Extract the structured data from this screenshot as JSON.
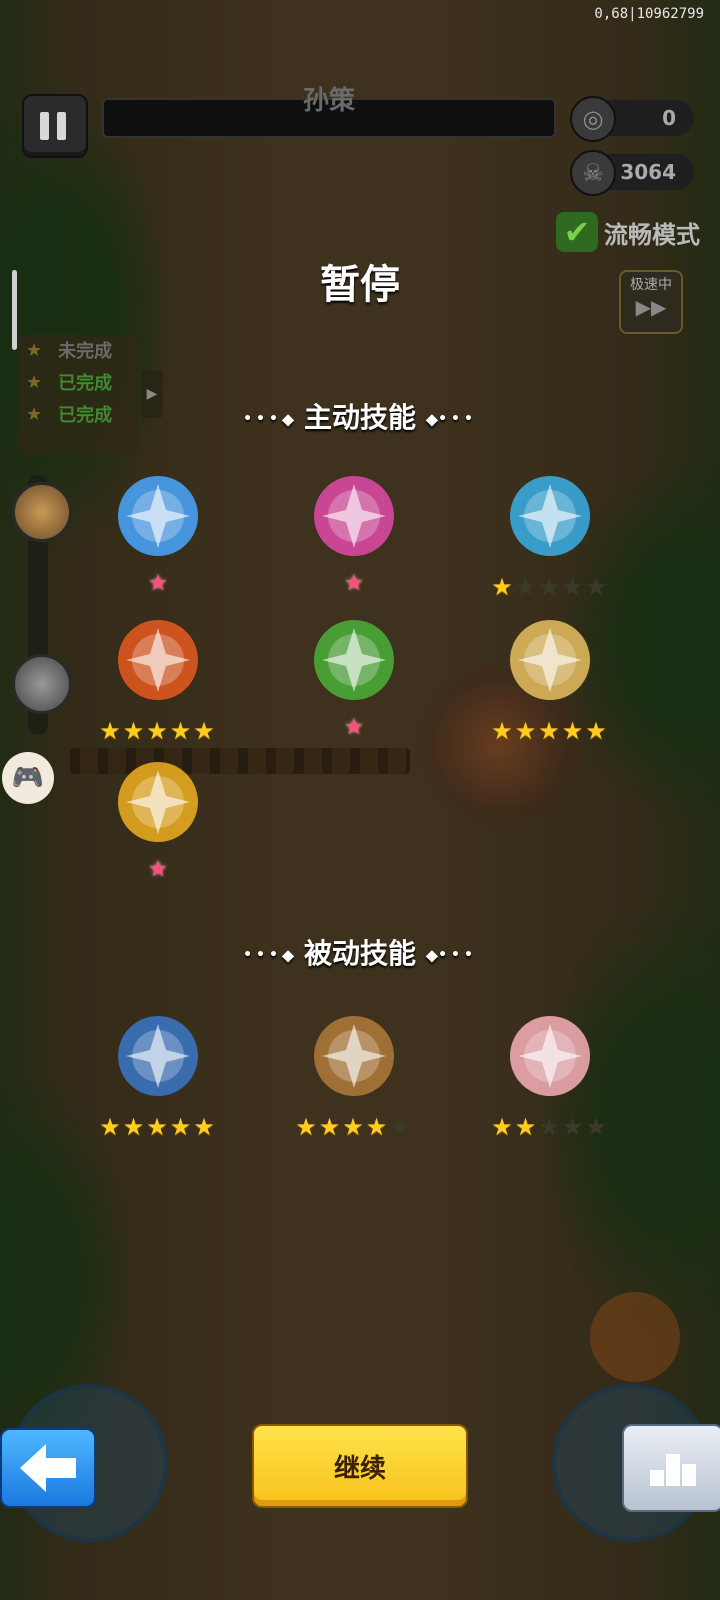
{
  "debug_text": "0,68|10962799",
  "boss": {
    "name": "孙策"
  },
  "counters": {
    "coins": "0",
    "kills": "3064"
  },
  "smooth_mode": {
    "label": "流畅模式"
  },
  "speed": {
    "label": "极速中",
    "arrow": "▶▶"
  },
  "quests": [
    {
      "label": "未完成"
    },
    {
      "label": "已完成"
    },
    {
      "label": "已完成"
    }
  ],
  "title": "暂停",
  "active_section": {
    "label": "主动技能"
  },
  "active_skills": [
    {
      "name": "ice-sword",
      "stars_on": 0,
      "stars_total": 0,
      "pink": true,
      "color": "#4aa8ff"
    },
    {
      "name": "phoenix-fan",
      "stars_on": 0,
      "stars_total": 0,
      "pink": true,
      "color": "#e04aa8"
    },
    {
      "name": "water-maiden",
      "stars_on": 1,
      "stars_total": 5,
      "pink": false,
      "color": "#3ab0e8"
    },
    {
      "name": "fire-scroll",
      "stars_on": 5,
      "stars_total": 5,
      "pink": false,
      "color": "#e85a20"
    },
    {
      "name": "wood-totem",
      "stars_on": 0,
      "stars_total": 0,
      "pink": true,
      "color": "#4ab03a"
    },
    {
      "name": "golden-dice",
      "stars_on": 5,
      "stars_total": 5,
      "pink": false,
      "color": "#e8c060"
    },
    {
      "name": "lightning-burst",
      "stars_on": 0,
      "stars_total": 0,
      "pink": true,
      "color": "#f0b020"
    }
  ],
  "passive_section": {
    "label": "被动技能"
  },
  "passive_skills": [
    {
      "name": "gauntlet",
      "stars_on": 5,
      "stars_total": 5,
      "color": "#3a78c8"
    },
    {
      "name": "ginseng-root",
      "stars_on": 4,
      "stars_total": 5,
      "color": "#b07a3a"
    },
    {
      "name": "peach",
      "stars_on": 2,
      "stars_total": 5,
      "color": "#f8b0b8"
    }
  ],
  "continue_button": {
    "label": "继续"
  }
}
